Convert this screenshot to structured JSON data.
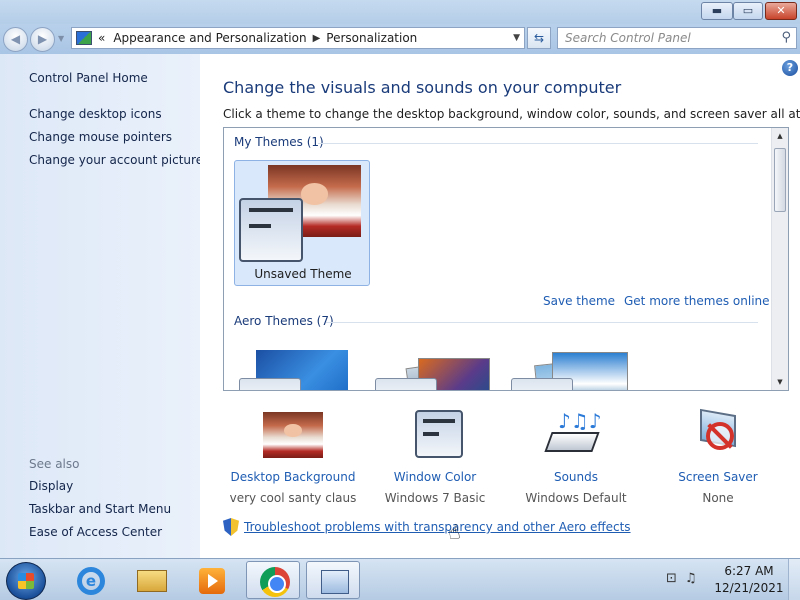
{
  "window": {
    "controls": {
      "minimize": "▬",
      "maximize": "▭",
      "close": "✕"
    }
  },
  "navigation": {
    "back": "◀",
    "forward": "▶",
    "address": {
      "prefix": "«",
      "crumbs": [
        "Appearance and Personalization",
        "Personalization"
      ],
      "separator": "▶"
    },
    "search": {
      "placeholder": "Search Control Panel"
    }
  },
  "sidebar": {
    "home": "Control Panel Home",
    "tasks": [
      "Change desktop icons",
      "Change mouse pointers",
      "Change your account picture"
    ],
    "see_also_title": "See also",
    "see_also": [
      "Display",
      "Taskbar and Start Menu",
      "Ease of Access Center"
    ]
  },
  "main": {
    "title": "Change the visuals and sounds on your computer",
    "subtitle": "Click a theme to change the desktop background, window color, sounds, and screen saver all at once.",
    "my_themes_header": "My Themes (1)",
    "unsaved_theme": "Unsaved Theme",
    "save_theme": "Save theme",
    "get_more": "Get more themes online",
    "aero_header": "Aero Themes (7)"
  },
  "options": [
    {
      "title": "Desktop Background",
      "value": "very cool santy claus",
      "icon": "desktop-background-icon"
    },
    {
      "title": "Window Color",
      "value": "Windows 7 Basic",
      "icon": "window-color-icon"
    },
    {
      "title": "Sounds",
      "value": "Windows Default",
      "icon": "sounds-icon"
    },
    {
      "title": "Screen Saver",
      "value": "None",
      "icon": "screen-saver-icon"
    }
  ],
  "troubleshoot_link": "Troubleshoot problems with transparency and other Aero effects",
  "taskbar": {
    "time": "6:27 AM",
    "date": "12/21/2021"
  },
  "colors": {
    "link": "#1f5db3",
    "heading": "#1a3b7a",
    "sidebar_bg": "#dde8f7",
    "selection": "#d9e8fb"
  }
}
